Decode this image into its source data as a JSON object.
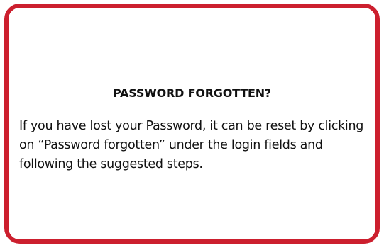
{
  "card": {
    "title": "PASSWORD FORGOTTEN?",
    "body": "If you have lost your Password, it can be reset by clicking on “Password forgotten” under the login fields and following the suggested steps."
  },
  "colors": {
    "border": "#cc1f2e",
    "background": "#ffffff",
    "text": "#111111"
  }
}
